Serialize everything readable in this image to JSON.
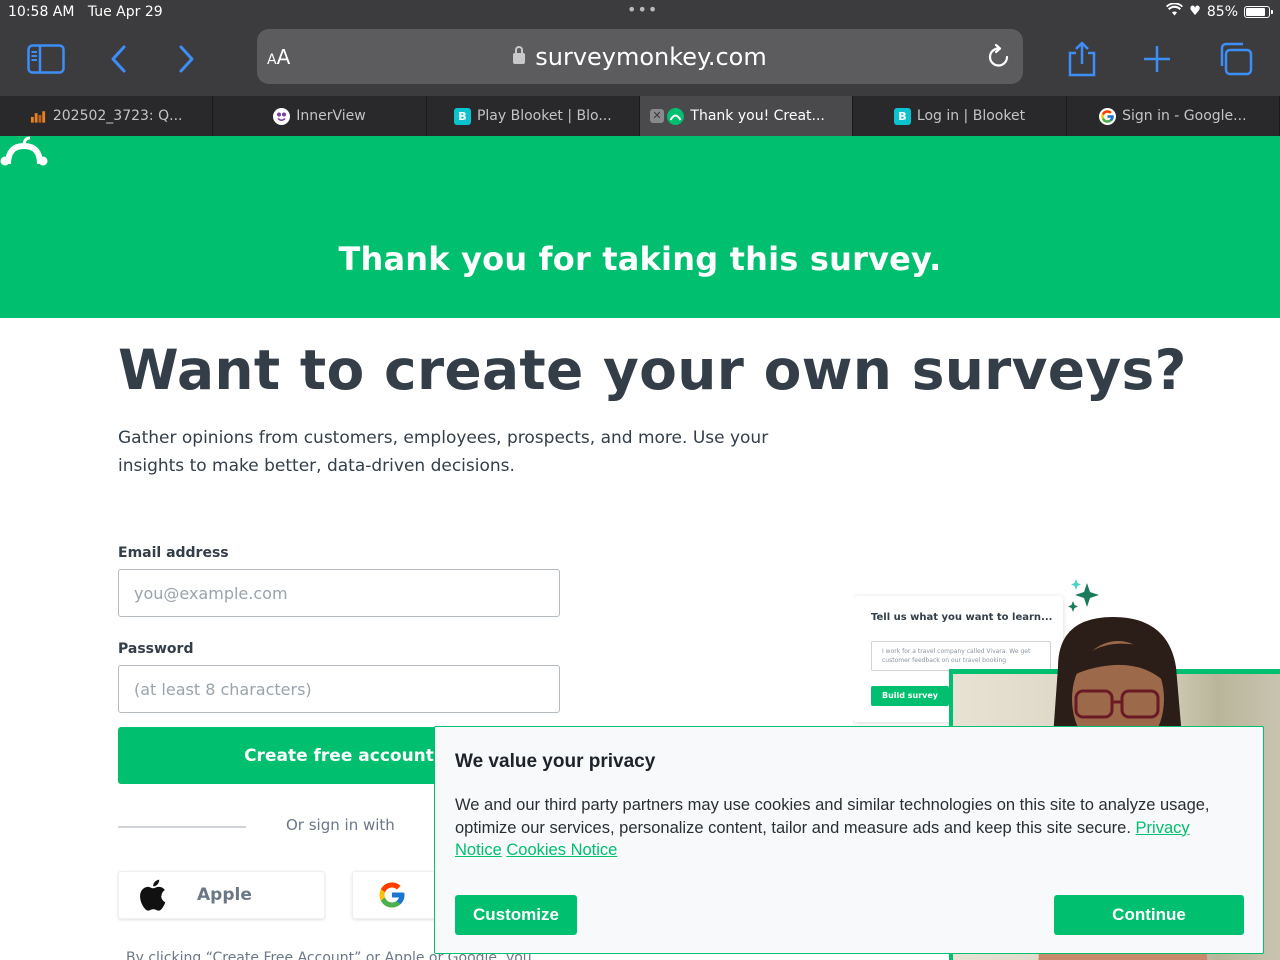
{
  "status_bar": {
    "time": "10:58 AM",
    "date": "Tue Apr 29",
    "battery": "85%",
    "battery_level": 0.85
  },
  "browser": {
    "text_size_label": "AA",
    "url": "surveymonkey.com",
    "tabs": [
      {
        "label": "202502_3723: Q...",
        "icon": "orange-chart-icon",
        "active": false
      },
      {
        "label": "InnerView",
        "icon": "innerview-icon",
        "active": false
      },
      {
        "label": "Play Blooket | Blo...",
        "icon": "blooket-icon",
        "active": false
      },
      {
        "label": "Thank you! Creat...",
        "icon": "surveymonkey-icon",
        "active": true
      },
      {
        "label": "Log in | Blooket",
        "icon": "blooket-icon",
        "active": false
      },
      {
        "label": "Sign in - Google...",
        "icon": "google-icon",
        "active": false
      }
    ]
  },
  "banner": {
    "title": "Thank you for taking this survey."
  },
  "main": {
    "headline": "Want to create your own surveys?",
    "description": "Gather opinions from customers, employees, prospects, and more. Use your insights to make better, data-driven decisions.",
    "email_label": "Email address",
    "email_placeholder": "you@example.com",
    "password_label": "Password",
    "password_placeholder": "(at least 8 characters)",
    "create_button": "Create free account",
    "or_sign_in": "Or sign in with",
    "apple_label": "Apple",
    "fine_print": "By clicking “Create Free Account” or Apple or Google, you"
  },
  "illustration": {
    "card_title": "Tell us what you want to learn...",
    "card_text": "I work for a travel company called Vivara. We get customer feedback on our travel booking",
    "card_button": "Build survey"
  },
  "cookie_modal": {
    "title": "We value your privacy",
    "body": "We and our third party partners may use cookies and similar technologies on this site to analyze usage, optimize our services, personalize content, tailor and measure ads and keep this site secure.",
    "privacy_link": "Privacy Notice",
    "cookies_link": "Cookies Notice",
    "customize_button": "Customize",
    "continue_button": "Continue"
  },
  "colors": {
    "brand_green": "#00bf6f",
    "text_dark": "#333e48",
    "browser_chrome": "#3c3c3e",
    "safari_blue": "#3d8ef7"
  }
}
